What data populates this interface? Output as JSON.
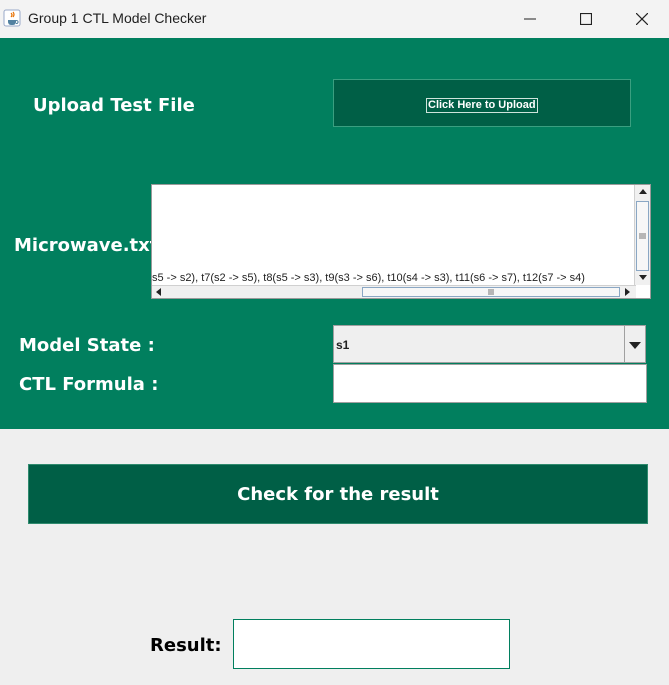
{
  "window": {
    "title": "Group 1 CTL Model Checker",
    "app_icon": "java-icon",
    "controls": [
      "minimize-icon",
      "maximize-icon",
      "close-icon"
    ]
  },
  "upload": {
    "label": "Upload Test File",
    "button_label": "Click Here to Upload"
  },
  "file": {
    "name": "Microwave.txt",
    "content_visible": "s5 -> s2), t7(s2 -> s5), t8(s5 -> s3), t9(s3 -> s6), t10(s4 -> s3), t11(s6 -> s7), t12(s7 -> s4)"
  },
  "model_state": {
    "label": "Model State :",
    "selected": "s1"
  },
  "ctl_formula": {
    "label": "CTL Formula :",
    "value": ""
  },
  "check_button": {
    "label": "Check for the result"
  },
  "result": {
    "label": "Result:",
    "value": ""
  },
  "colors": {
    "panel_green": "#017f5e",
    "button_dark_green": "#005f46",
    "background": "#efefef"
  }
}
